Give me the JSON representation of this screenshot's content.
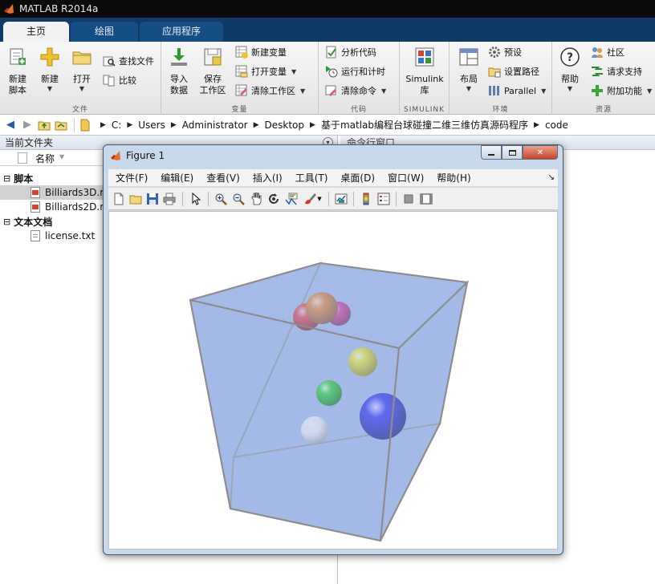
{
  "app": {
    "title": "MATLAB R2014a"
  },
  "tabs": [
    {
      "label": "主页",
      "active": true
    },
    {
      "label": "绘图",
      "active": false
    },
    {
      "label": "应用程序",
      "active": false
    }
  ],
  "ribbon": {
    "file": {
      "label": "文件",
      "new_script": "新建\n脚本",
      "new": "新建",
      "open": "打开",
      "find_files": "查找文件",
      "compare": "比较"
    },
    "variable": {
      "label": "变量",
      "import_data": "导入\n数据",
      "save_workspace": "保存\n工作区",
      "new_variable": "新建变量",
      "open_variable": "打开变量",
      "clear_workspace": "清除工作区"
    },
    "code": {
      "label": "代码",
      "analyze_code": "分析代码",
      "run_and_time": "运行和计时",
      "clear_commands": "清除命令"
    },
    "simulink": {
      "label": "SIMULINK",
      "library": "Simulink\n库"
    },
    "environment": {
      "label": "环境",
      "layout": "布局",
      "preferences": "预设",
      "set_path": "设置路径",
      "parallel": "Parallel"
    },
    "resources": {
      "label": "资源",
      "help": "帮助",
      "community": "社区",
      "request_support": "请求支持",
      "add_ons": "附加功能"
    }
  },
  "address_bar": {
    "crumbs": [
      "C:",
      "Users",
      "Administrator",
      "Desktop",
      "基于matlab编程台球碰撞二维三维仿真源码程序",
      "code"
    ]
  },
  "current_folder": {
    "title": "当前文件夹",
    "column_name": "名称",
    "sections": [
      {
        "title": "脚本",
        "files": [
          "Billiards3D.m",
          "Billiards2D.m"
        ]
      },
      {
        "title": "文本文档",
        "files": [
          "license.txt"
        ]
      }
    ]
  },
  "command_window": {
    "title": "命令行窗口"
  },
  "figure": {
    "title": "Figure 1",
    "menus": [
      "文件(F)",
      "编辑(E)",
      "查看(V)",
      "插入(I)",
      "工具(T)",
      "桌面(D)",
      "窗口(W)",
      "帮助(H)"
    ],
    "toolbar_icons": [
      "new-figure-icon",
      "open-file-icon",
      "save-icon",
      "print-icon",
      "pointer-icon",
      "zoom-in-icon",
      "zoom-out-icon",
      "pan-icon",
      "rotate-3d-icon",
      "data-cursor-icon",
      "brush-icon",
      "link-plot-icon",
      "colorbar-icon",
      "legend-icon",
      "hide-plot-tools-icon",
      "show-plot-tools-icon"
    ],
    "scene": {
      "box_face_color": "#9db4e4",
      "box_edge_color": "#8c8c8c",
      "balls": [
        {
          "color": "red",
          "hex": "#e81010"
        },
        {
          "color": "magenta",
          "hex": "#e8147c"
        },
        {
          "color": "orange",
          "hex": "#f07808"
        },
        {
          "color": "yellow",
          "hex": "#f0e808"
        },
        {
          "color": "green",
          "hex": "#10d010"
        },
        {
          "color": "blue",
          "hex": "#1010f0"
        },
        {
          "color": "white",
          "hex": "#f4f4f4"
        }
      ]
    }
  }
}
